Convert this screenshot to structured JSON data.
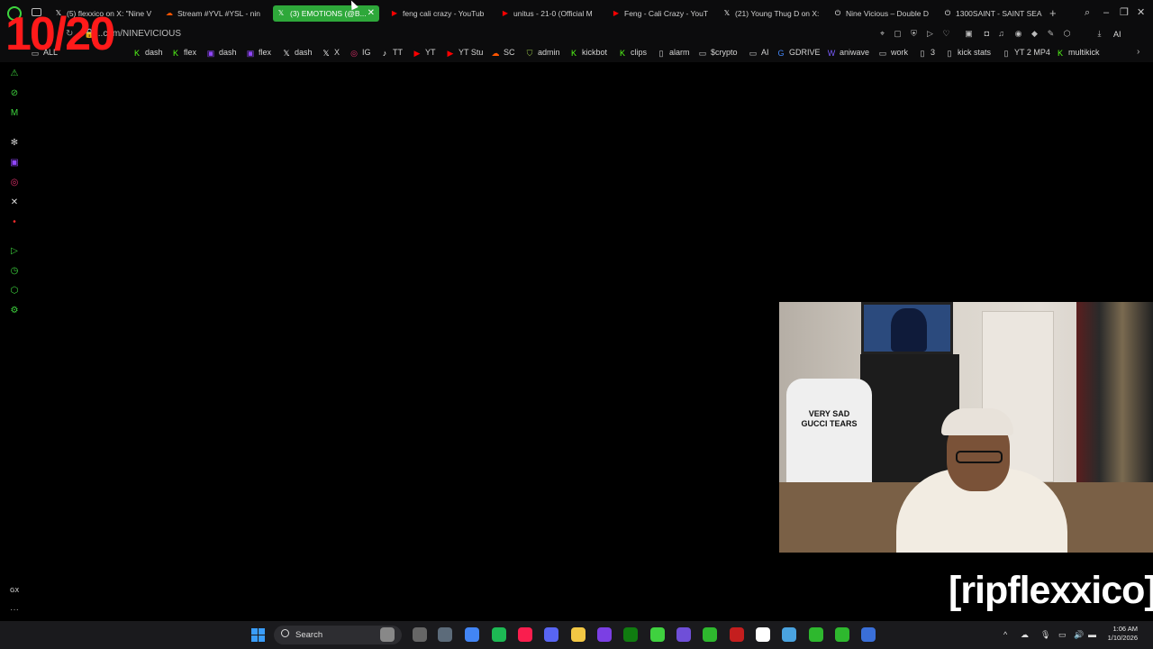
{
  "overlay": {
    "counter": "10/20",
    "tag": "[ripflexxico]"
  },
  "tabs": [
    {
      "label": "(5) flexxico on X: \"Nine V",
      "icon": "x-icon",
      "color": "#ffffff"
    },
    {
      "label": "Stream #YVL #YSL - nin",
      "icon": "soundcloud-icon",
      "color": "#ff5500"
    },
    {
      "label": "(3) EMOTIONS (@B...",
      "icon": "x-icon",
      "color": "#ffffff",
      "active": true
    },
    {
      "label": "feng cali crazy - YouTub",
      "icon": "youtube-icon",
      "color": "#ff0000"
    },
    {
      "label": "unitus - 21-0 (Official M",
      "icon": "youtube-icon",
      "color": "#ff0000"
    },
    {
      "label": "Feng - Cali Crazy - YouT",
      "icon": "youtube-icon",
      "color": "#ff0000"
    },
    {
      "label": "(21) Young Thug D on X:",
      "icon": "x-icon",
      "color": "#ffffff"
    },
    {
      "label": "Nine Vicious – Double D",
      "icon": "genius-icon",
      "color": "#ffffff"
    },
    {
      "label": "1300SAINT - SAINT SEA",
      "icon": "genius-icon",
      "color": "#ffffff"
    }
  ],
  "address": {
    "url": "...com/NINEVICIOUS",
    "ai_label": "AI"
  },
  "bookmarks": [
    {
      "label": "ALL",
      "icon": "folder-icon",
      "color": "#cccccc"
    },
    {
      "label": "dash",
      "icon": "kick-icon",
      "color": "#53fc18"
    },
    {
      "label": "flex",
      "icon": "kick-icon",
      "color": "#53fc18"
    },
    {
      "label": "dash",
      "icon": "twitch-icon",
      "color": "#9146ff"
    },
    {
      "label": "flex",
      "icon": "twitch-icon",
      "color": "#9146ff"
    },
    {
      "label": "dash",
      "icon": "x-icon",
      "color": "#ffffff"
    },
    {
      "label": "X",
      "icon": "x-icon",
      "color": "#ffffff"
    },
    {
      "label": "IG",
      "icon": "instagram-icon",
      "color": "#e1306c"
    },
    {
      "label": "TT",
      "icon": "tiktok-icon",
      "color": "#ffffff"
    },
    {
      "label": "YT",
      "icon": "youtube-icon",
      "color": "#ff0000"
    },
    {
      "label": "YT Stu",
      "icon": "youtube-icon",
      "color": "#ff0000"
    },
    {
      "label": "SC",
      "icon": "soundcloud-icon",
      "color": "#ff5500"
    },
    {
      "label": "admin",
      "icon": "shopify-icon",
      "color": "#95bf47"
    },
    {
      "label": "kickbot",
      "icon": "kick-icon",
      "color": "#53fc18"
    },
    {
      "label": "clips",
      "icon": "kick-icon",
      "color": "#53fc18"
    },
    {
      "label": "alarm",
      "icon": "page-icon",
      "color": "#cccccc"
    },
    {
      "label": "$crypto",
      "icon": "folder-icon",
      "color": "#cccccc"
    },
    {
      "label": "AI",
      "icon": "folder-icon",
      "color": "#cccccc"
    },
    {
      "label": "GDRIVE",
      "icon": "google-icon",
      "color": "#4285f4"
    },
    {
      "label": "aniwave",
      "icon": "aniwave-icon",
      "color": "#7a5cff"
    },
    {
      "label": "work",
      "icon": "folder-icon",
      "color": "#cccccc"
    },
    {
      "label": "3",
      "icon": "page-icon",
      "color": "#cccccc"
    },
    {
      "label": "kick stats",
      "icon": "page-icon",
      "color": "#cccccc"
    },
    {
      "label": "YT 2 MP4",
      "icon": "page-icon",
      "color": "#cccccc"
    },
    {
      "label": "multikick",
      "icon": "kick-icon",
      "color": "#53fc18"
    }
  ],
  "webcam": {
    "shirt_text": "VERY SAD\nGUCCI TEARS"
  },
  "sidebar": {
    "gx_label": "GX",
    "more": "···"
  },
  "taskbar": {
    "search_label": "Search",
    "clock_time": "1:06 AM",
    "clock_date": "1/10/2026",
    "apps": [
      {
        "name": "file-explorer-icon",
        "color": "#888888"
      },
      {
        "name": "notes-icon",
        "color": "#666666"
      },
      {
        "name": "steam-icon",
        "color": "#5c6b7a"
      },
      {
        "name": "chrome-icon",
        "color": "#4285f4"
      },
      {
        "name": "spotify-icon",
        "color": "#1db954"
      },
      {
        "name": "opera-gx-icon",
        "color": "#fa1e4e"
      },
      {
        "name": "discord-icon",
        "color": "#5865f2"
      },
      {
        "name": "folder-icon",
        "color": "#f2c744"
      },
      {
        "name": "purple-app-icon",
        "color": "#7b3fe4"
      },
      {
        "name": "xbox-icon",
        "color": "#107c10"
      },
      {
        "name": "green-app-icon",
        "color": "#3fd13f"
      },
      {
        "name": "game-controller-icon",
        "color": "#6f4fd8"
      },
      {
        "name": "green-app-icon-2",
        "color": "#2eb82e"
      },
      {
        "name": "red-app-icon",
        "color": "#c41e1e"
      },
      {
        "name": "capcut-icon",
        "color": "#ffffff"
      },
      {
        "name": "notepad-icon",
        "color": "#4aa3df"
      },
      {
        "name": "green-app-icon-3",
        "color": "#2eb82e"
      },
      {
        "name": "green-app-icon-4",
        "color": "#2eb82e"
      },
      {
        "name": "calculator-icon",
        "color": "#3a6fd8"
      }
    ]
  }
}
